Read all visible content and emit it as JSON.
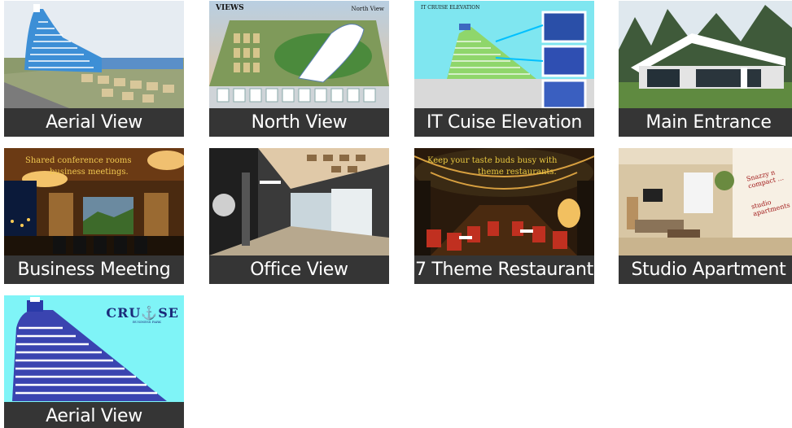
{
  "gallery": {
    "items": [
      {
        "caption": "Aerial View"
      },
      {
        "caption": "North View",
        "overlay_left": "VIEWS",
        "overlay_right": "North View"
      },
      {
        "caption": "IT Cuise Elevation",
        "overlay": "IT CRUISE ELEVATION"
      },
      {
        "caption": "Main Entrance"
      },
      {
        "caption": "Business Meeting",
        "overlay_line1": "Shared conference rooms",
        "overlay_line2": "business meetings."
      },
      {
        "caption": "Office View"
      },
      {
        "caption": "7 Theme Restaurant",
        "overlay_line1": "Keep your taste buds busy with",
        "overlay_line2": "theme restaurants."
      },
      {
        "caption": "Studio Apartment",
        "overlay_line1": "Snazzy n compact ...",
        "overlay_line2": "studio apartments"
      },
      {
        "caption": "Aerial View",
        "logo": "CRU⚓SE",
        "logo_sub": "BUSINESS PARK"
      }
    ]
  }
}
